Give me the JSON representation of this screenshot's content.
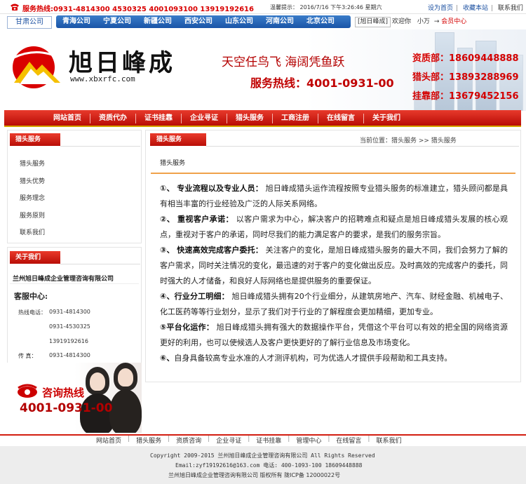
{
  "top": {
    "hotline": "服务热线:0931-4814300  4530325  4001093100  13919192616",
    "tip": "温馨提示： 2016/7/16 下午3:26:46 星期六",
    "links": [
      "设为首页",
      "收藏本站",
      "联系我们"
    ]
  },
  "cities": {
    "active": "甘肃公司",
    "items": [
      "青海公司",
      "宁夏公司",
      "新疆公司",
      "西安公司",
      "山东公司",
      "河南公司",
      "北京公司"
    ]
  },
  "user": {
    "site_label": "[旭日峰成]",
    "welcome": "欢迎你",
    "name": "小万",
    "arrow": "→",
    "member_link": "会员中心"
  },
  "header": {
    "logo_text": "旭日峰成",
    "logo_url": "www.xbxrfc.com",
    "slogan": "天空任鸟飞 海阔凭鱼跃",
    "hotline": "服务热线：4001-0931-00",
    "phones": [
      "资质部：18609448888",
      "猎头部：13893288969",
      "挂靠部：13679452156"
    ]
  },
  "main_nav": [
    "网站首页",
    "资质代办",
    "证书挂靠",
    "企业寻证",
    "猎头服务",
    "工商注册",
    "在线留言",
    "关于我们"
  ],
  "sidebar": {
    "services_title": "猎头服务",
    "services": [
      "猎头服务",
      "猎头优势",
      "服务理念",
      "服务原则",
      "联系我们"
    ],
    "about_title": "关于我们",
    "company": "兰州旭日峰成企业管理咨询有限公司",
    "service_center": "客服中心:",
    "tel_label": "热线电话：",
    "tels": [
      "0931-4814300",
      "0931-4530325",
      "13919192616"
    ],
    "fax_label": "传      真：",
    "fax": "0931-4814300",
    "consult_label": "咨询热线",
    "consult_number": "4001-0931-00"
  },
  "content": {
    "title": "猎头服务",
    "breadcrumb": "当前位置：猎头服务 >> 猎头服务",
    "sub_label": "猎头服务",
    "paragraphs": [
      {
        "num": "①、",
        "head": "专业流程以及专业人员：",
        "text": "旭日峰成猎头运作流程按照专业猎头服务的标准建立，猎头顾问都是具有相当丰富的行业经验及广泛的人际关系网络。"
      },
      {
        "num": "②、",
        "head": "重视客户承诺：",
        "text": "以客户需求为中心，解决客户的招聘难点和疑点是旭日峰成猎头发展的核心观点，重视对于客户的承诺，同时尽我们的能力满足客户的要求，是我们的服务宗旨。"
      },
      {
        "num": "③、",
        "head": "快速高效完成客户委托：",
        "text": "关注客户的变化，是旭日峰成猎头服务的最大不同，我们会努力了解的客户需求，同时关注情况的变化，最迅速的对于客户的变化做出反应。及时高效的完成客户的委托，同时强大的人才储备，和良好人际网络也是提供服务的重要保证。"
      },
      {
        "num": "④、",
        "head": "行业分工明细：",
        "text": "旭日峰成猎头拥有20个行业细分，从建筑房地产、汽车、财经金融、机械电子、化工医药等等行业划分，显示了我们对于行业的了解程度会更加精细，更加专业。"
      },
      {
        "num": "⑤",
        "head": "平台化运作：",
        "text": "旭日峰成猎头拥有强大的数据操作平台，凭借这个平台可以有效的把全国的网络资源更好的利用，也可以使候选人及客户更快更好的了解行业信息及市场变化。"
      },
      {
        "num": "⑥、",
        "head": "",
        "text": "自身具备较高专业水准的人才测评机构，可为优选人才提供手段帮助和工具支持。"
      }
    ]
  },
  "footer": {
    "links": [
      "网站首页",
      "猎头服务",
      "资质咨询",
      "企业寻证",
      "证书挂靠",
      "管理中心",
      "在线留言",
      "联系我们"
    ],
    "copyright": "Copyright 2009-2015 兰州旭日峰成企业管理咨询有限公司 All Rights Reserved",
    "contact": "Email:zyf19192616@163.com 电话: 400-1093-100 18609448888",
    "icp": "兰州旭日峰成企业管理咨询有限公司 版权所有  陇ICP备 12000022号"
  },
  "colors": {
    "brand_red": "#c8150c",
    "nav_blue": "#1a55a8",
    "accent_orange": "#f0a24a"
  }
}
